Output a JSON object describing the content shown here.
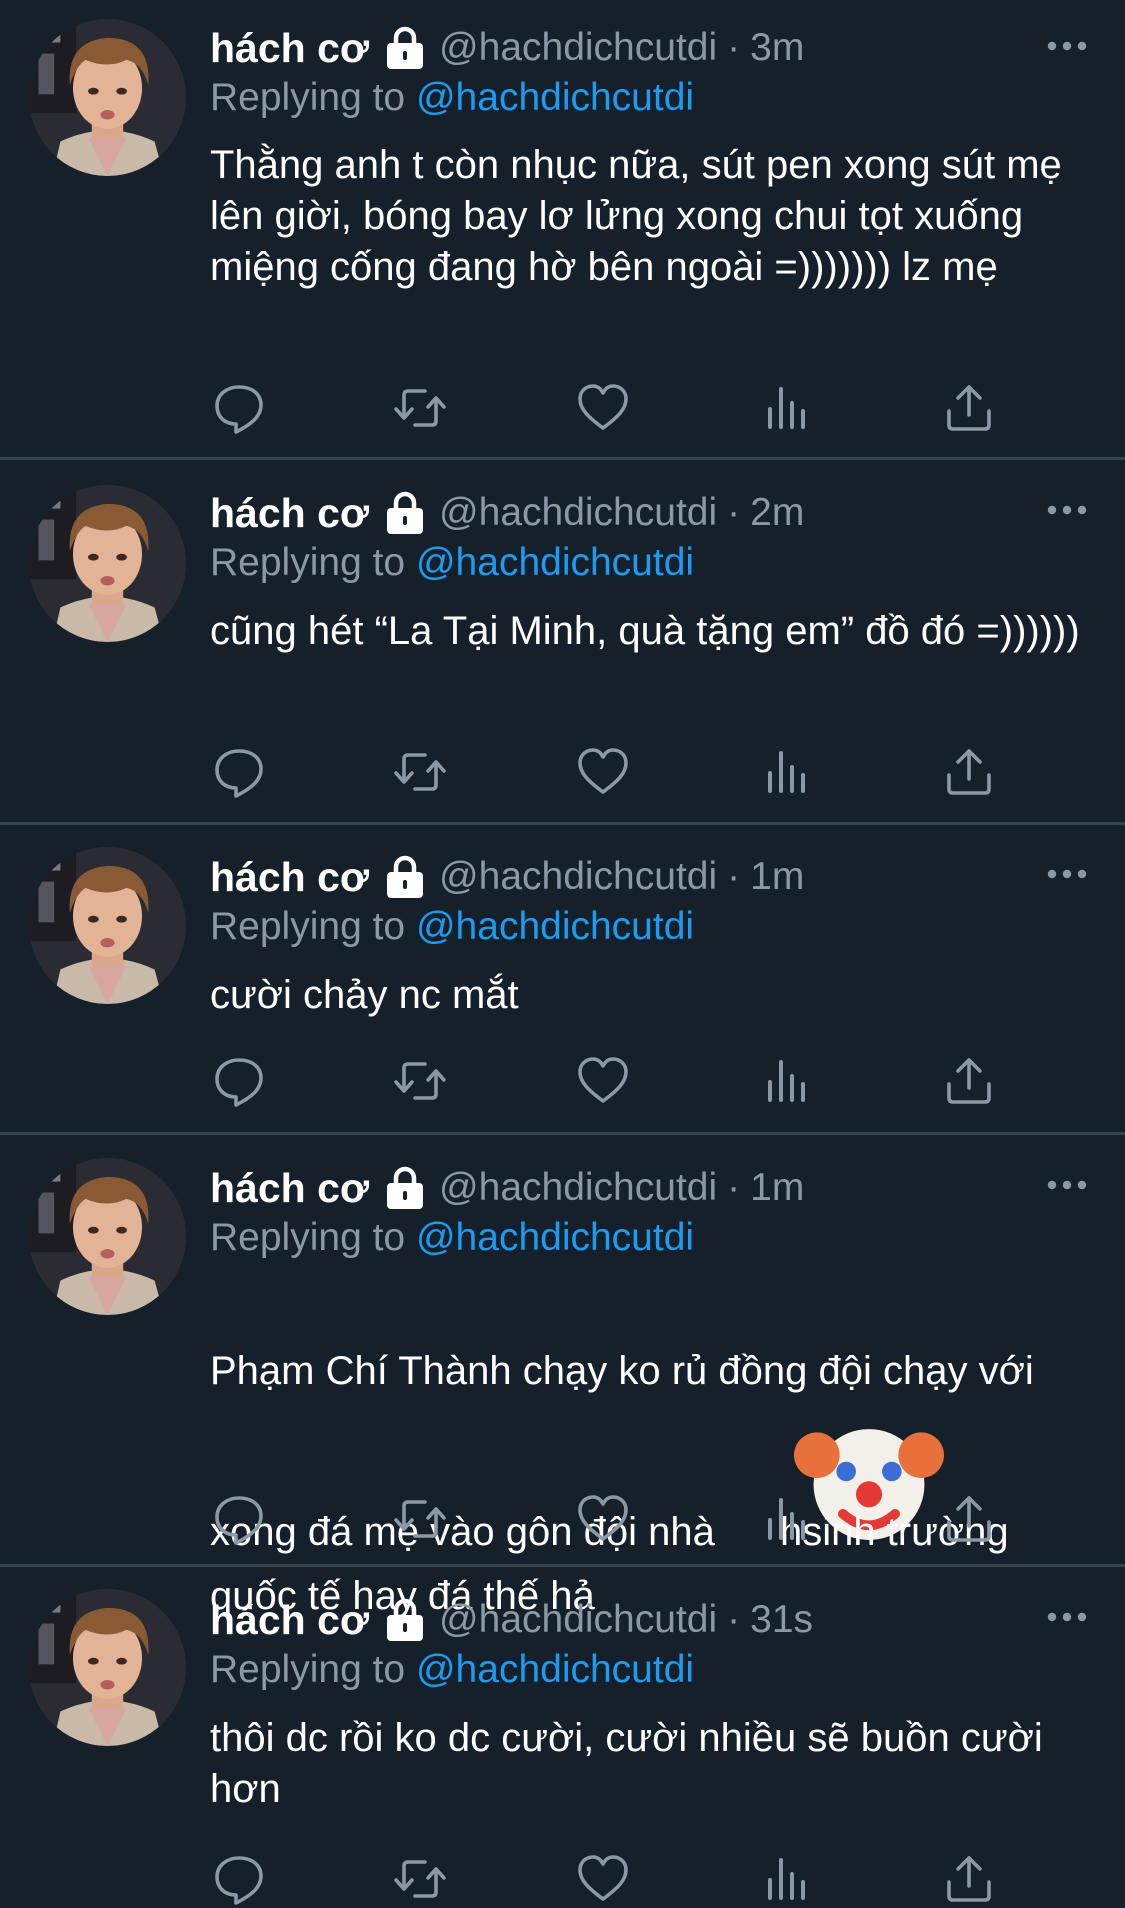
{
  "tweets": [
    {
      "display_name": "hách cơ",
      "handle": "@hachdichcutdi",
      "time": "3m",
      "reply_prefix": "Replying to",
      "reply_to": "@hachdichcutdi",
      "text": "Thằng anh t còn nhục nữa, sút pen xong sút mẹ lên giời, bóng bay lơ lửng xong chui tọt xuống miệng cống đang hờ bên ngoài =))))))) lz mẹ"
    },
    {
      "display_name": "hách cơ",
      "handle": "@hachdichcutdi",
      "time": "2m",
      "reply_prefix": "Replying to",
      "reply_to": "@hachdichcutdi",
      "text": "cũng hét “La Tại Minh, quà tặng em” đồ đó =))))))"
    },
    {
      "display_name": "hách cơ",
      "handle": "@hachdichcutdi",
      "time": "1m",
      "reply_prefix": "Replying to",
      "reply_to": "@hachdichcutdi",
      "text": "cười chảy nc mắt"
    },
    {
      "display_name": "hách cơ",
      "handle": "@hachdichcutdi",
      "time": "1m",
      "reply_prefix": "Replying to",
      "reply_to": "@hachdichcutdi",
      "text_before_emoji": "Phạm Chí Thành chạy ko rủ đồng đội chạy với xong đá mẹ vào gôn đội nhà",
      "emoji": "clown-face",
      "text_after_emoji": " hsinh trường quốc tế hay đá thế hả"
    },
    {
      "display_name": "hách cơ",
      "handle": "@hachdichcutdi",
      "time": "31s",
      "reply_prefix": "Replying to",
      "reply_to": "@hachdichcutdi",
      "text": "thôi dc rồi ko dc cười, cười nhiều sẽ buồn cười hơn"
    }
  ],
  "icons": {
    "lock": "lock-icon",
    "more": "more-horizontal-icon",
    "reply": "reply-icon",
    "retweet": "retweet-icon",
    "like": "heart-icon",
    "analytics": "analytics-icon",
    "share": "share-icon"
  },
  "colors": {
    "background": "#15202b",
    "divider": "#38444d",
    "secondary_text": "#8b98a5",
    "link": "#1d9bf0",
    "primary_text": "#ffffff"
  }
}
